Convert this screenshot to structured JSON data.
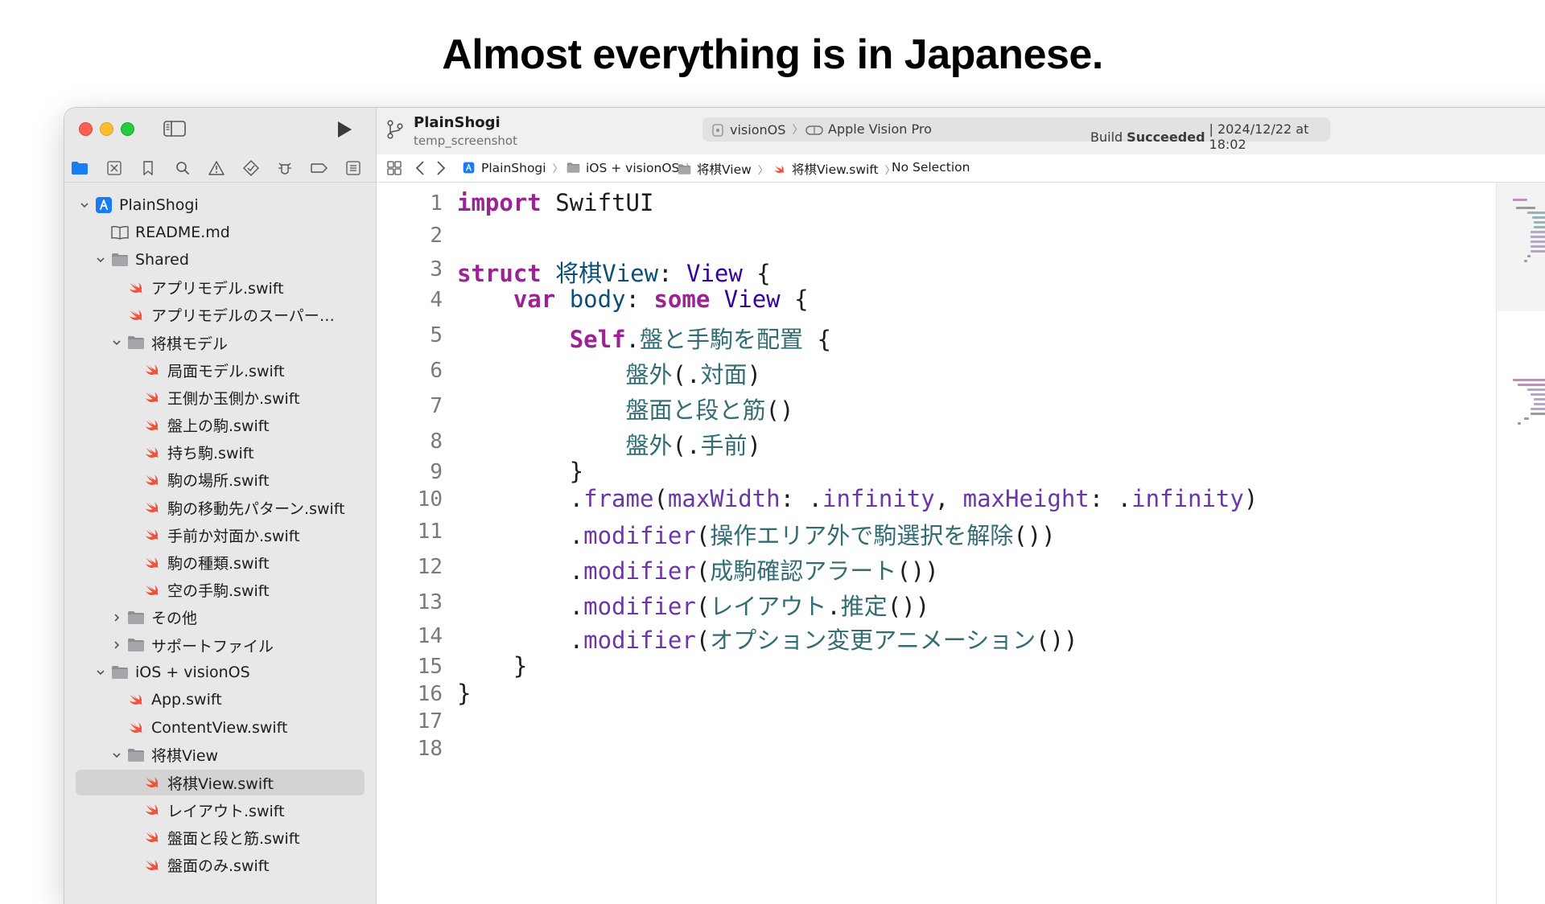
{
  "headline": "Almost everything is in Japanese.",
  "colors": {
    "keyword": "#9b2393",
    "type": "#0b4f79",
    "function": "#326d74",
    "member": "#6c36a9",
    "swift_icon": "#f05138",
    "folder": "#8e8e93",
    "accent": "#1a7cf5"
  },
  "toolbar": {
    "project_name": "PlainShogi",
    "project_sub": "temp_screenshot",
    "scheme": "visionOS",
    "destination": "Apple Vision Pro",
    "build_prefix": "Build",
    "build_status": "Succeeded",
    "build_time": "| 2024/12/22 at 18:02"
  },
  "jumpbar": {
    "crumbs": [
      {
        "label": "PlainShogi",
        "icon": "project-icon"
      },
      {
        "label": "iOS + visionOS",
        "icon": "folder-icon"
      },
      {
        "label": "将棋View",
        "icon": "folder-icon"
      },
      {
        "label": "将棋View.swift",
        "icon": "swift-icon"
      },
      {
        "label": "No Selection",
        "icon": ""
      }
    ]
  },
  "sidebar": {
    "nav_icons": [
      "folder-icon",
      "source-control-icon",
      "bookmark-icon",
      "search-icon",
      "warning-icon",
      "test-icon",
      "debug-icon",
      "breakpoint-icon",
      "report-icon"
    ],
    "tree": [
      {
        "label": "PlainShogi",
        "icon": "project-icon",
        "level": 0,
        "chevron": "open"
      },
      {
        "label": "README.md",
        "icon": "book-icon",
        "level": 1,
        "chevron": "none"
      },
      {
        "label": "Shared",
        "icon": "folder-icon",
        "level": 1,
        "chevron": "open"
      },
      {
        "label": "アプリモデル.swift",
        "icon": "swift-icon",
        "level": 2,
        "chevron": "none"
      },
      {
        "label": "アプリモデルのスーパーク…",
        "icon": "swift-icon",
        "level": 2,
        "chevron": "none"
      },
      {
        "label": "将棋モデル",
        "icon": "folder-icon",
        "level": 2,
        "chevron": "open"
      },
      {
        "label": "局面モデル.swift",
        "icon": "swift-icon",
        "level": 3,
        "chevron": "none"
      },
      {
        "label": "王側か玉側か.swift",
        "icon": "swift-icon",
        "level": 3,
        "chevron": "none"
      },
      {
        "label": "盤上の駒.swift",
        "icon": "swift-icon",
        "level": 3,
        "chevron": "none"
      },
      {
        "label": "持ち駒.swift",
        "icon": "swift-icon",
        "level": 3,
        "chevron": "none"
      },
      {
        "label": "駒の場所.swift",
        "icon": "swift-icon",
        "level": 3,
        "chevron": "none"
      },
      {
        "label": "駒の移動先パターン.swift",
        "icon": "swift-icon",
        "level": 3,
        "chevron": "none"
      },
      {
        "label": "手前か対面か.swift",
        "icon": "swift-icon",
        "level": 3,
        "chevron": "none"
      },
      {
        "label": "駒の種類.swift",
        "icon": "swift-icon",
        "level": 3,
        "chevron": "none"
      },
      {
        "label": "空の手駒.swift",
        "icon": "swift-icon",
        "level": 3,
        "chevron": "none"
      },
      {
        "label": "その他",
        "icon": "folder-icon",
        "level": 2,
        "chevron": "closed"
      },
      {
        "label": "サポートファイル",
        "icon": "folder-icon",
        "level": 2,
        "chevron": "closed"
      },
      {
        "label": "iOS + visionOS",
        "icon": "folder-icon",
        "level": 1,
        "chevron": "open"
      },
      {
        "label": "App.swift",
        "icon": "swift-icon",
        "level": 2,
        "chevron": "none"
      },
      {
        "label": "ContentView.swift",
        "icon": "swift-icon",
        "level": 2,
        "chevron": "none"
      },
      {
        "label": "将棋View",
        "icon": "folder-icon",
        "level": 2,
        "chevron": "open"
      },
      {
        "label": "将棋View.swift",
        "icon": "swift-icon",
        "level": 3,
        "chevron": "none",
        "selected": true
      },
      {
        "label": "レイアウト.swift",
        "icon": "swift-icon",
        "level": 3,
        "chevron": "none"
      },
      {
        "label": "盤面と段と筋.swift",
        "icon": "swift-icon",
        "level": 3,
        "chevron": "none"
      },
      {
        "label": "盤面のみ.swift",
        "icon": "swift-icon",
        "level": 3,
        "chevron": "none"
      }
    ]
  },
  "editor": {
    "lines": [
      {
        "n": "1",
        "tokens": [
          [
            "kw",
            "import"
          ],
          [
            "txt",
            " SwiftUI"
          ]
        ]
      },
      {
        "n": "2",
        "tokens": []
      },
      {
        "n": "3",
        "tokens": [
          [
            "kw",
            "struct"
          ],
          [
            "txt",
            " "
          ],
          [
            "ty",
            "将棋View"
          ],
          [
            "txt",
            ": "
          ],
          [
            "tyb",
            "View"
          ],
          [
            "txt",
            " {"
          ]
        ]
      },
      {
        "n": "4",
        "tokens": [
          [
            "txt",
            "    "
          ],
          [
            "kw",
            "var"
          ],
          [
            "txt",
            " "
          ],
          [
            "ty",
            "body"
          ],
          [
            "txt",
            ": "
          ],
          [
            "kw",
            "some"
          ],
          [
            "txt",
            " "
          ],
          [
            "tyb",
            "View"
          ],
          [
            "txt",
            " {"
          ]
        ]
      },
      {
        "n": "5",
        "tokens": [
          [
            "txt",
            "        "
          ],
          [
            "kw",
            "Self"
          ],
          [
            "txt",
            "."
          ],
          [
            "fn",
            "盤と手駒を配置"
          ],
          [
            "txt",
            " {"
          ]
        ]
      },
      {
        "n": "6",
        "tokens": [
          [
            "txt",
            "            "
          ],
          [
            "fn",
            "盤外"
          ],
          [
            "txt",
            "(."
          ],
          [
            "fn",
            "対面"
          ],
          [
            "txt",
            ")"
          ]
        ]
      },
      {
        "n": "7",
        "tokens": [
          [
            "txt",
            "            "
          ],
          [
            "fn",
            "盤面と段と筋"
          ],
          [
            "txt",
            "()"
          ]
        ]
      },
      {
        "n": "8",
        "tokens": [
          [
            "txt",
            "            "
          ],
          [
            "fn",
            "盤外"
          ],
          [
            "txt",
            "(."
          ],
          [
            "fn",
            "手前"
          ],
          [
            "txt",
            ")"
          ]
        ]
      },
      {
        "n": "9",
        "tokens": [
          [
            "txt",
            "        }"
          ]
        ]
      },
      {
        "n": "10",
        "tokens": [
          [
            "txt",
            "        ."
          ],
          [
            "mem",
            "frame"
          ],
          [
            "txt",
            "("
          ],
          [
            "mem",
            "maxWidth"
          ],
          [
            "txt",
            ": ."
          ],
          [
            "mem",
            "infinity"
          ],
          [
            "txt",
            ", "
          ],
          [
            "mem",
            "maxHeight"
          ],
          [
            "txt",
            ": ."
          ],
          [
            "mem",
            "infinity"
          ],
          [
            "txt",
            ")"
          ]
        ]
      },
      {
        "n": "11",
        "tokens": [
          [
            "txt",
            "        ."
          ],
          [
            "mem",
            "modifier"
          ],
          [
            "txt",
            "("
          ],
          [
            "fn",
            "操作エリア外で駒選択を解除"
          ],
          [
            "txt",
            "())"
          ]
        ]
      },
      {
        "n": "12",
        "tokens": [
          [
            "txt",
            "        ."
          ],
          [
            "mem",
            "modifier"
          ],
          [
            "txt",
            "("
          ],
          [
            "fn",
            "成駒確認アラート"
          ],
          [
            "txt",
            "())"
          ]
        ]
      },
      {
        "n": "13",
        "tokens": [
          [
            "txt",
            "        ."
          ],
          [
            "mem",
            "modifier"
          ],
          [
            "txt",
            "("
          ],
          [
            "fn",
            "レイアウト"
          ],
          [
            "txt",
            "."
          ],
          [
            "fn",
            "推定"
          ],
          [
            "txt",
            "())"
          ]
        ]
      },
      {
        "n": "14",
        "tokens": [
          [
            "txt",
            "        ."
          ],
          [
            "mem",
            "modifier"
          ],
          [
            "txt",
            "("
          ],
          [
            "fn",
            "オプション変更アニメーション"
          ],
          [
            "txt",
            "())"
          ]
        ]
      },
      {
        "n": "15",
        "tokens": [
          [
            "txt",
            "    }"
          ]
        ]
      },
      {
        "n": "16",
        "tokens": [
          [
            "txt",
            "}"
          ]
        ]
      },
      {
        "n": "17",
        "tokens": []
      },
      {
        "n": "18",
        "tokens": []
      }
    ]
  }
}
